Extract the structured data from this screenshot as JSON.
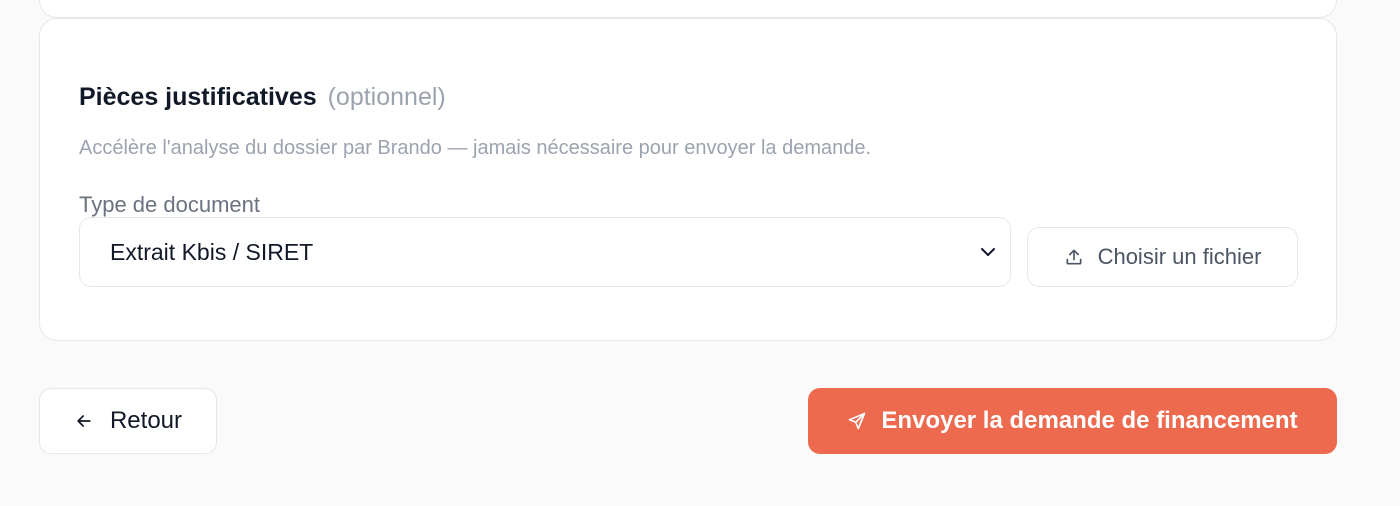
{
  "documents_section": {
    "title": "Pièces justificatives",
    "title_suffix": "(optionnel)",
    "description": "Accélère l'analyse du dossier par Brando — jamais nécessaire pour envoyer la demande.",
    "document_type_label": "Type de document",
    "document_type_selected": "Extrait Kbis / SIRET",
    "upload_button_label": "Choisir un fichier"
  },
  "footer": {
    "back_button_label": "Retour",
    "submit_button_label": "Envoyer la demande de financement"
  },
  "icons": {
    "select": "chevron-down-icon",
    "upload": "upload-icon",
    "back": "arrow-left-icon",
    "submit": "send-icon"
  },
  "colors": {
    "accent": "#ed6a4f",
    "border": "#e5e7eb",
    "muted_text": "#9ca3af"
  }
}
